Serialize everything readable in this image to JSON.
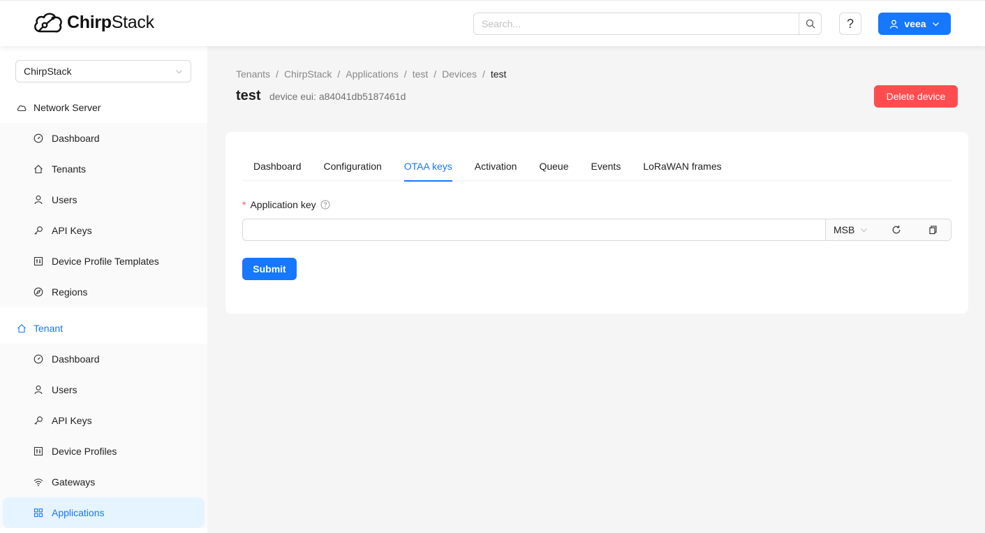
{
  "header": {
    "logo_bold": "Chirp",
    "logo_rest": "Stack",
    "search_placeholder": "Search...",
    "help_label": "?",
    "user_label": "veea"
  },
  "sidebar": {
    "tenant_select": "ChirpStack",
    "network_server": {
      "title": "Network Server",
      "items": [
        {
          "label": "Dashboard"
        },
        {
          "label": "Tenants"
        },
        {
          "label": "Users"
        },
        {
          "label": "API Keys"
        },
        {
          "label": "Device Profile Templates"
        },
        {
          "label": "Regions"
        }
      ]
    },
    "tenant": {
      "title": "Tenant",
      "items": [
        {
          "label": "Dashboard"
        },
        {
          "label": "Users"
        },
        {
          "label": "API Keys"
        },
        {
          "label": "Device Profiles"
        },
        {
          "label": "Gateways"
        },
        {
          "label": "Applications"
        }
      ]
    }
  },
  "breadcrumb": [
    "Tenants",
    "ChirpStack",
    "Applications",
    "test",
    "Devices",
    "test"
  ],
  "page": {
    "title": "test",
    "subtitle": "device eui: a84041db5187461d",
    "delete_label": "Delete device"
  },
  "tabs": [
    {
      "label": "Dashboard"
    },
    {
      "label": "Configuration"
    },
    {
      "label": "OTAA keys"
    },
    {
      "label": "Activation"
    },
    {
      "label": "Queue"
    },
    {
      "label": "Events"
    },
    {
      "label": "LoRaWAN frames"
    }
  ],
  "active_tab": "OTAA keys",
  "form": {
    "required_mark": "*",
    "app_key_label": "Application key",
    "app_key_value": "",
    "byte_order": "MSB",
    "submit_label": "Submit"
  },
  "colors": {
    "primary": "#1677ff",
    "danger": "#ff4d4f",
    "selected_bg": "#e6f4ff"
  }
}
